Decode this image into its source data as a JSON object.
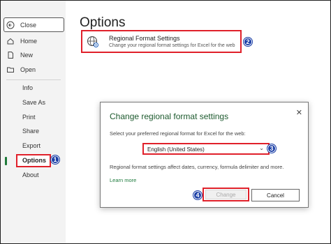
{
  "sidebar": {
    "close_label": "Close",
    "items": [
      {
        "label": "Home",
        "icon": "home-icon"
      },
      {
        "label": "New",
        "icon": "new-file-icon"
      },
      {
        "label": "Open",
        "icon": "folder-open-icon"
      }
    ],
    "sections": [
      "Info",
      "Save As",
      "Print",
      "Share",
      "Export",
      "Options",
      "About"
    ],
    "active_item": "Options"
  },
  "main": {
    "title": "Options",
    "regional": {
      "title": "Regional Format Settings",
      "subtitle": "Change your regional format settings for Excel for the web"
    }
  },
  "dialog": {
    "title": "Change regional format settings",
    "prompt": "Select your preferred regional format for Excel for the web:",
    "selected_region": "English (United States)",
    "info": "Regional format settings affect dates, currency, formula delimiter and more.",
    "link": "Learn more",
    "change_label": "Change",
    "cancel_label": "Cancel"
  },
  "badges": [
    "1",
    "2",
    "3",
    "4"
  ],
  "colors": {
    "highlight": "#e0202a",
    "badge": "#1b3fa6",
    "accent": "#1d5a2e"
  }
}
